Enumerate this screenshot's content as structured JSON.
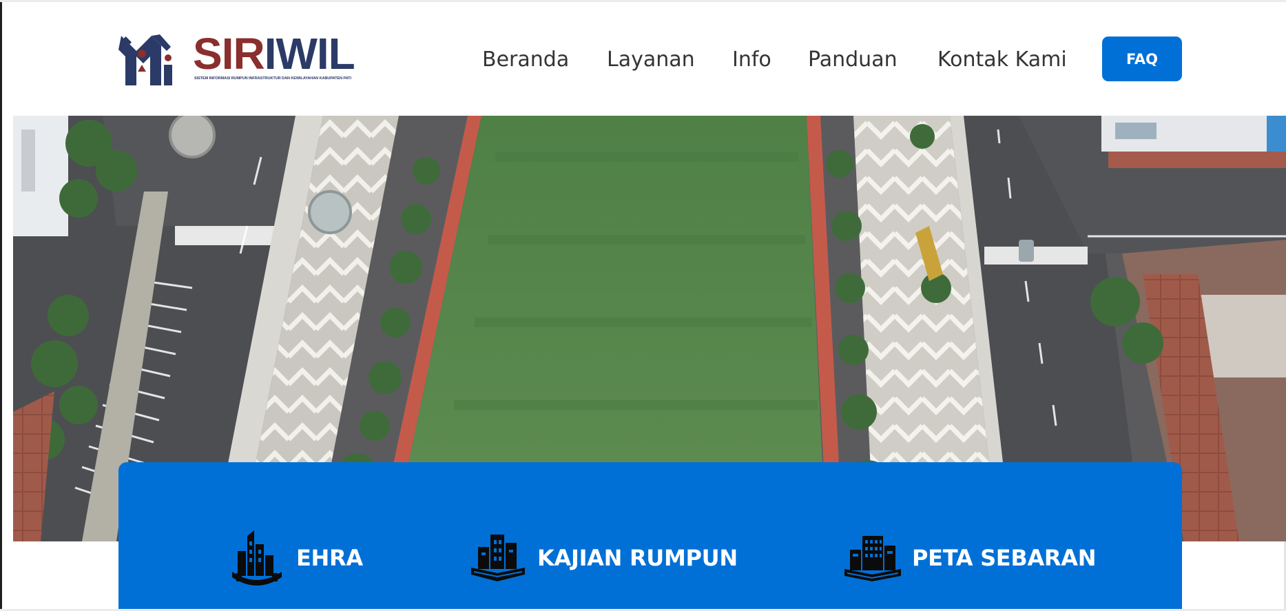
{
  "brand": {
    "name_part1": "SIR",
    "name_part2": "IWIL",
    "tagline": "SISTEM INFORMASI RUMPUN INFRASTRUKTUR DAN KEWILAYAHAN KABUPATEN PATI",
    "primary_color": "#0070d7",
    "navy_color": "#2b3a67",
    "red_color": "#8a2e2e"
  },
  "nav": {
    "items": [
      "Beranda",
      "Layanan",
      "Info",
      "Panduan",
      "Kontak Kami"
    ],
    "faq_label": "FAQ"
  },
  "hero": {
    "image_subject": "aerial-town-square"
  },
  "services": [
    {
      "label": "EHRA",
      "icon": "city-skyline-icon"
    },
    {
      "label": "KAJIAN RUMPUN",
      "icon": "buildings-book-icon"
    },
    {
      "label": "PETA SEBARAN",
      "icon": "building-book-icon"
    }
  ]
}
